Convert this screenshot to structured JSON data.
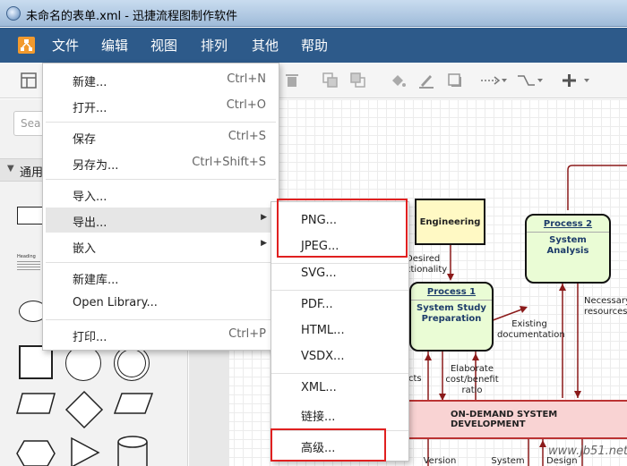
{
  "window": {
    "title": "未命名的表单.xml - 迅捷流程图制作软件"
  },
  "menubar": {
    "items": [
      "文件",
      "编辑",
      "视图",
      "排列",
      "其他",
      "帮助"
    ]
  },
  "sidebar": {
    "search_placeholder": "Sea",
    "section_label": "通用",
    "heading_shape_label": "Heading"
  },
  "file_menu": {
    "new": {
      "label": "新建...",
      "shortcut": "Ctrl+N"
    },
    "open": {
      "label": "打开...",
      "shortcut": "Ctrl+O"
    },
    "save": {
      "label": "保存",
      "shortcut": "Ctrl+S"
    },
    "save_as": {
      "label": "另存为...",
      "shortcut": "Ctrl+Shift+S"
    },
    "import": {
      "label": "导入..."
    },
    "export": {
      "label": "导出..."
    },
    "embed": {
      "label": "嵌入"
    },
    "new_library": {
      "label": "新建库..."
    },
    "open_library": {
      "label": "Open Library..."
    },
    "print": {
      "label": "打印...",
      "shortcut": "Ctrl+P"
    }
  },
  "export_submenu": [
    "PNG...",
    "JPEG...",
    "SVG...",
    "PDF...",
    "HTML...",
    "VSDX...",
    "XML...",
    "链接...",
    "高级..."
  ],
  "diagram": {
    "engineering": "Engineering",
    "process1": {
      "num": "Process 1",
      "name": "System Study Preparation"
    },
    "process2": {
      "num": "Process 2",
      "name": "System Analysis"
    },
    "labels": {
      "desired": "Desired ctionality",
      "existing": "Existing documentation",
      "necessary": "Necessary resources",
      "elaborate": "Elaborate cost/benefit ratio",
      "cts": "cts",
      "version": "Version",
      "system": "System",
      "design": "Design"
    },
    "ondemand": "ON-DEMAND SYSTEM DEVELOPMENT"
  },
  "watermark": "www.jb51.net"
}
